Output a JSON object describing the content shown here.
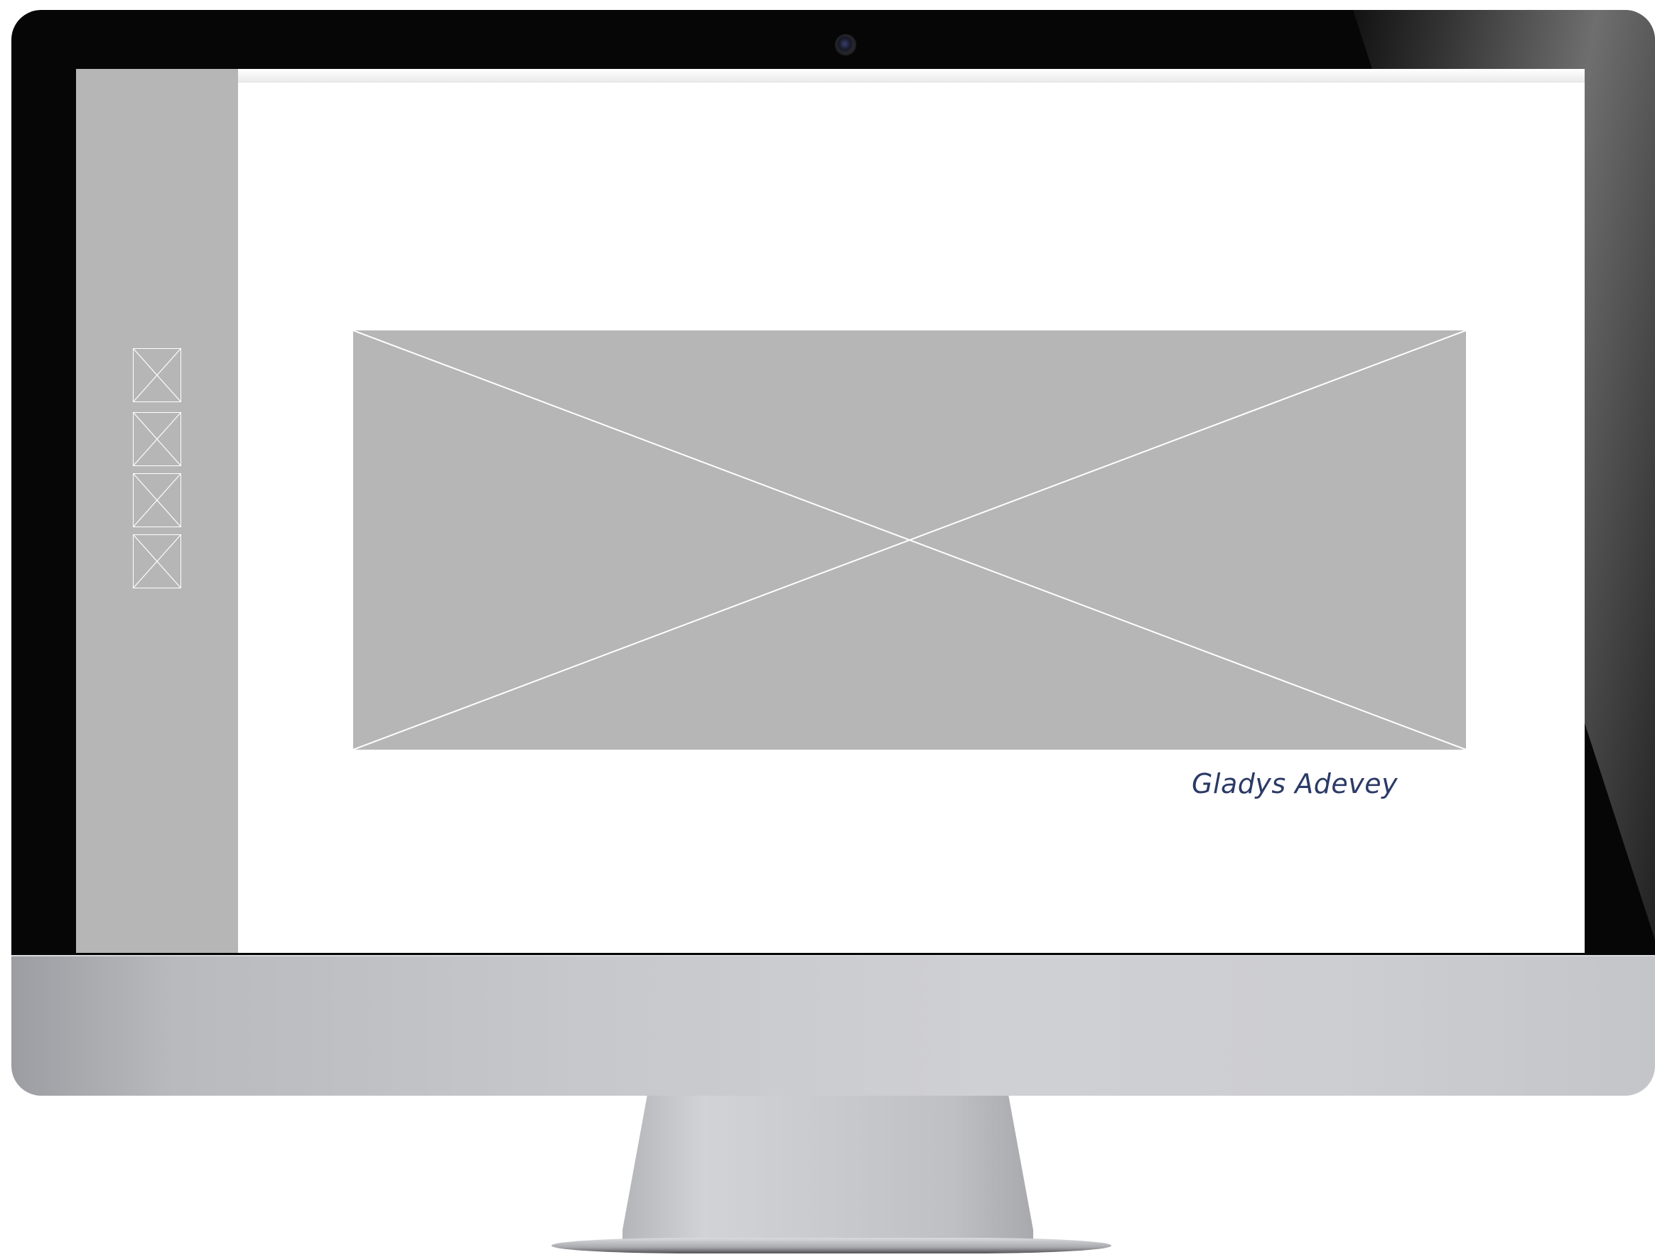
{
  "screen": {
    "caption": "Gladys Adevey",
    "caption_color": "#2b3a66",
    "placeholder_color": "#b6b6b6"
  },
  "sidebar": {
    "thumbnails": [
      {
        "icon": "image-placeholder-icon"
      },
      {
        "icon": "image-placeholder-icon"
      },
      {
        "icon": "image-placeholder-icon"
      },
      {
        "icon": "image-placeholder-icon"
      }
    ]
  },
  "hero": {
    "icon": "image-placeholder-icon"
  }
}
